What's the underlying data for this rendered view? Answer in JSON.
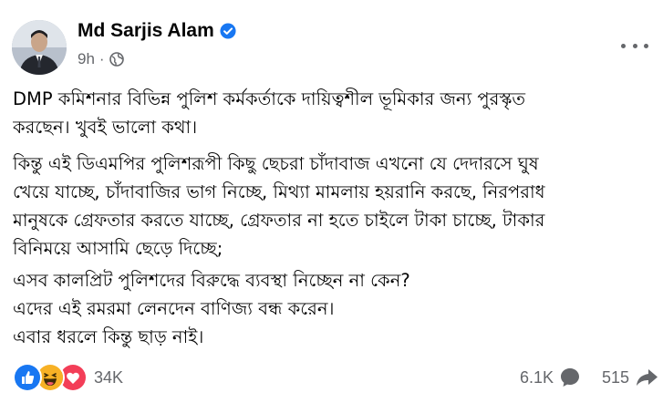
{
  "post": {
    "author": "Md Sarjis Alam",
    "time": "9h",
    "separator": "·",
    "paragraphs": [
      {
        "lines": [
          "DMP কমিশনার বিভিন্ন পুলিশ কর্মকর্তাকে দায়িত্বশীল ভূমিকার জন্য পুরস্কৃত",
          "করছেন। খুবই ভালো কথা।"
        ]
      },
      {
        "lines": [
          "কিন্তু এই ডিএমপির পুলিশরূপী কিছু ছেচরা চাঁদাবাজ  এখনো যে দেদারসে ঘুষ",
          "খেয়ে যাচ্ছে, চাঁদাবাজির ভাগ নিচ্ছে, মিথ্যা মামলায় হয়রানি করছে, নিরপরাধ",
          "মানুষকে গ্রেফতার করতে যাচ্ছে, গ্রেফতার না হতে চাইলে টাকা চাচ্ছে, টাকার",
          "বিনিময়ে আসামি ছেড়ে দিচ্ছে;"
        ]
      },
      {
        "lines": [
          "এসব কালপ্রিট পুলিশদের বিরুদ্ধে ব্যবস্থা নিচ্ছেন না কেন?",
          "এদের এই রমরমা লেনদেন বাণিজ্য বন্ধ করেন।",
          "এবার ধরলে কিন্তু ছাড় নাই।"
        ]
      }
    ]
  },
  "stats": {
    "reactions_count": "34K",
    "comments_count": "6.1K",
    "shares_count": "515"
  },
  "icons": {
    "verified": "verified-badge-icon",
    "audience": "globe-icon",
    "more": "more-options-icon",
    "reactions": [
      "like-icon",
      "haha-icon",
      "love-icon"
    ],
    "comment": "comment-icon",
    "share": "share-icon"
  },
  "colors": {
    "verified": "#1877f2",
    "like": "#1877f2",
    "haha": "#f7b125",
    "love": "#f33e58",
    "secondary_text": "#65676b"
  }
}
